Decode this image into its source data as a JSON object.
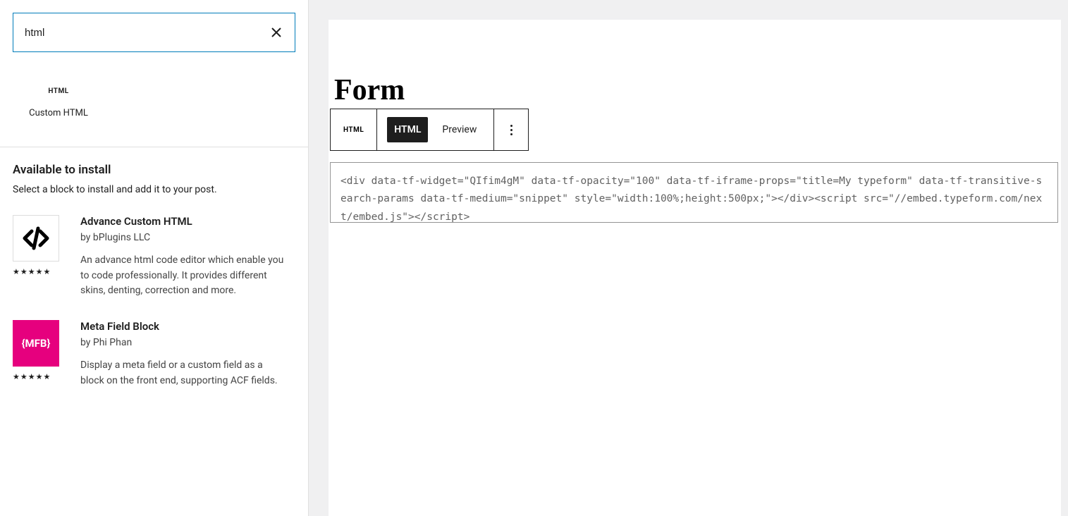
{
  "sidebar": {
    "search_value": "html",
    "result_block": {
      "icon_text": "HTML",
      "label": "Custom HTML"
    },
    "install": {
      "heading": "Available to install",
      "sub": "Select a block to install and add it to your post.",
      "plugins": [
        {
          "title": "Advance Custom HTML",
          "author": "by bPlugins LLC",
          "desc": "An advance html code editor which enable you to code professionally. It provides different skins, denting, correction and more.",
          "stars": "★★★★★",
          "icon_kind": "code"
        },
        {
          "title": "Meta Field Block",
          "author": "by Phi Phan",
          "desc": "Display a meta field or a custom field as a block on the front end, supporting ACF fields.",
          "stars": "★★★★★",
          "icon_kind": "mfb",
          "icon_text": "{MFB}"
        }
      ]
    }
  },
  "editor": {
    "page_title": "Form",
    "toolbar": {
      "block_icon": "HTML",
      "seg_html": "HTML",
      "seg_preview": "Preview"
    },
    "code": "<div data-tf-widget=\"QIfim4gM\" data-tf-opacity=\"100\" data-tf-iframe-props=\"title=My typeform\" data-tf-transitive-search-params data-tf-medium=\"snippet\" style=\"width:100%;height:500px;\"></div><script src=\"//embed.typeform.com/next/embed.js\"></script>"
  }
}
